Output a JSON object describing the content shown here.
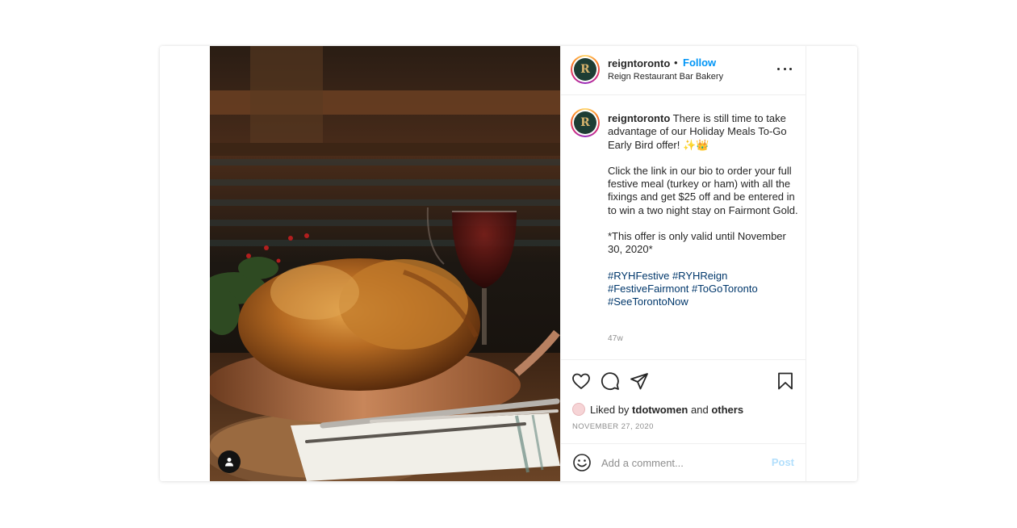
{
  "post": {
    "username": "reigntoronto",
    "avatar_letter": "R",
    "separator": "•",
    "follow_label": "Follow",
    "location": "Reign Restaurant Bar Bakery",
    "caption": {
      "line1": "There is still time to take advantage of our Holiday Meals To-Go Early Bird offer! ✨👑",
      "paragraph2": "Click the link in our bio to order your full festive meal (turkey or ham) with all the fixings and get $25 off and be entered in to win a two night stay on Fairmont Gold.",
      "paragraph3": "*This offer is only valid until November 30, 2020*",
      "hashtags": "#RYHFestive #RYHReign #FestiveFairmont #ToGoToronto #SeeTorontoNow"
    },
    "time_ago": "47w",
    "liked_by_prefix": "Liked by",
    "liked_by_user": "tdotwomen",
    "liked_by_and": "and",
    "liked_by_others": "others",
    "date": "NOVEMBER 27, 2020",
    "comment_placeholder": "Add a comment...",
    "post_label": "Post"
  },
  "icons": {
    "more": "more-options-icon",
    "like": "heart-icon",
    "comment": "comment-icon",
    "share": "paper-plane-icon",
    "save": "bookmark-icon",
    "emoji": "emoji-smile-icon",
    "user_tag": "user-tag-icon"
  },
  "colors": {
    "follow": "#0095f6",
    "hashtag": "#00376b",
    "muted": "#8e8e8e",
    "post_disabled": "#b2dffc"
  }
}
